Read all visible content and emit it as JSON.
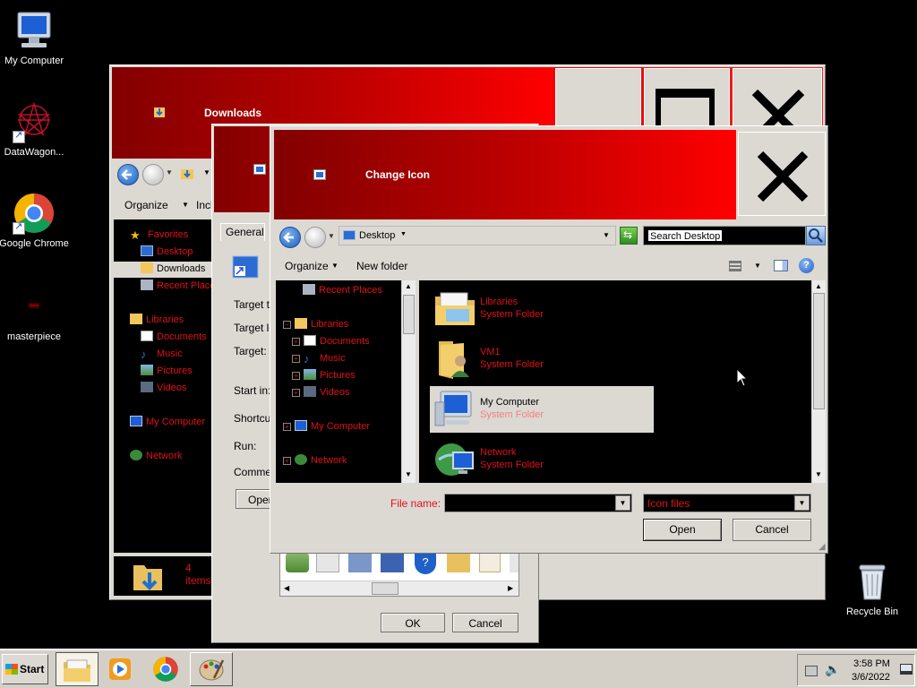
{
  "desktop_icons": {
    "my_computer": "My Computer",
    "datawagon": "DataWagon...",
    "chrome": "Google Chrome",
    "masterpiece": "masterpiece",
    "recycle_bin": "Recycle Bin"
  },
  "explorer": {
    "title": "Downloads",
    "toolbar": {
      "organize": "Organize",
      "include": "Inclu"
    },
    "nav": [
      {
        "label": "Favorites"
      },
      {
        "label": "Desktop"
      },
      {
        "label": "Downloads"
      },
      {
        "label": "Recent Places"
      },
      {
        "label": "Libraries"
      },
      {
        "label": "Documents"
      },
      {
        "label": "Music"
      },
      {
        "label": "Pictures"
      },
      {
        "label": "Videos"
      },
      {
        "label": "My Computer"
      },
      {
        "label": "Network"
      }
    ],
    "status": "4 items"
  },
  "properties": {
    "tab": "General",
    "fields": [
      "Target ty",
      "Target lo",
      "Target:",
      "Start in:",
      "Shortcut",
      "Run:",
      "Commen"
    ],
    "open_button": "Open",
    "ok": "OK",
    "cancel": "Cancel"
  },
  "change_icon": {
    "title": "Change Icon",
    "address": "Desktop",
    "search_placeholder": "Search Desktop",
    "toolbar": {
      "organize": "Organize",
      "new_folder": "New folder"
    },
    "nav": [
      {
        "label": "Recent Places"
      },
      {
        "label": "Libraries"
      },
      {
        "label": "Documents"
      },
      {
        "label": "Music"
      },
      {
        "label": "Pictures"
      },
      {
        "label": "Videos"
      },
      {
        "label": "My Computer"
      },
      {
        "label": "Network"
      }
    ],
    "items": [
      {
        "name": "Libraries",
        "type": "System Folder"
      },
      {
        "name": "VM1",
        "type": "System Folder"
      },
      {
        "name": "My Computer",
        "type": "System Folder"
      },
      {
        "name": "Network",
        "type": "System Folder"
      }
    ],
    "file_name_label": "File name:",
    "file_name_value": "",
    "filter": "Icon files",
    "open": "Open",
    "cancel": "Cancel"
  },
  "taskbar": {
    "start": "Start",
    "time": "3:58 PM",
    "date": "3/6/2022"
  }
}
